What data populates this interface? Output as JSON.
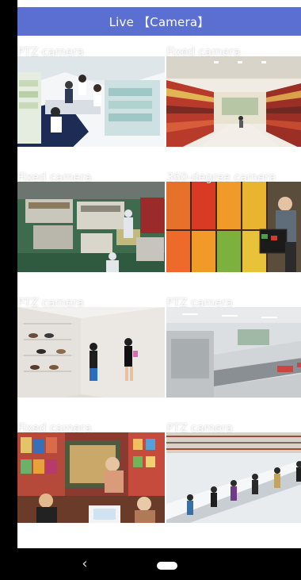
{
  "appbar": {
    "title": "Live 【Camera】"
  },
  "tiles": [
    {
      "label": "PTZ camera",
      "scene": "pharmacy"
    },
    {
      "label": "Fixed camera",
      "scene": "supermarket-aisle"
    },
    {
      "label": "Fixed camera",
      "scene": "factory-floor"
    },
    {
      "label": "360-degree camera",
      "scene": "produce-shopper"
    },
    {
      "label": "PTZ camera",
      "scene": "shoe-store"
    },
    {
      "label": "PTZ camera",
      "scene": "warehouse-conveyor"
    },
    {
      "label": "Fixed camera",
      "scene": "bookstore"
    },
    {
      "label": "PTZ camera",
      "scene": "escalator-crowd"
    }
  ],
  "navbar": {
    "back_icon": "chevron-left-icon",
    "home_icon": "home-pill-icon"
  },
  "colors": {
    "appbar_bg": "#5b6fd1",
    "appbar_text": "#ffffff",
    "navbar_bg": "#000000"
  }
}
